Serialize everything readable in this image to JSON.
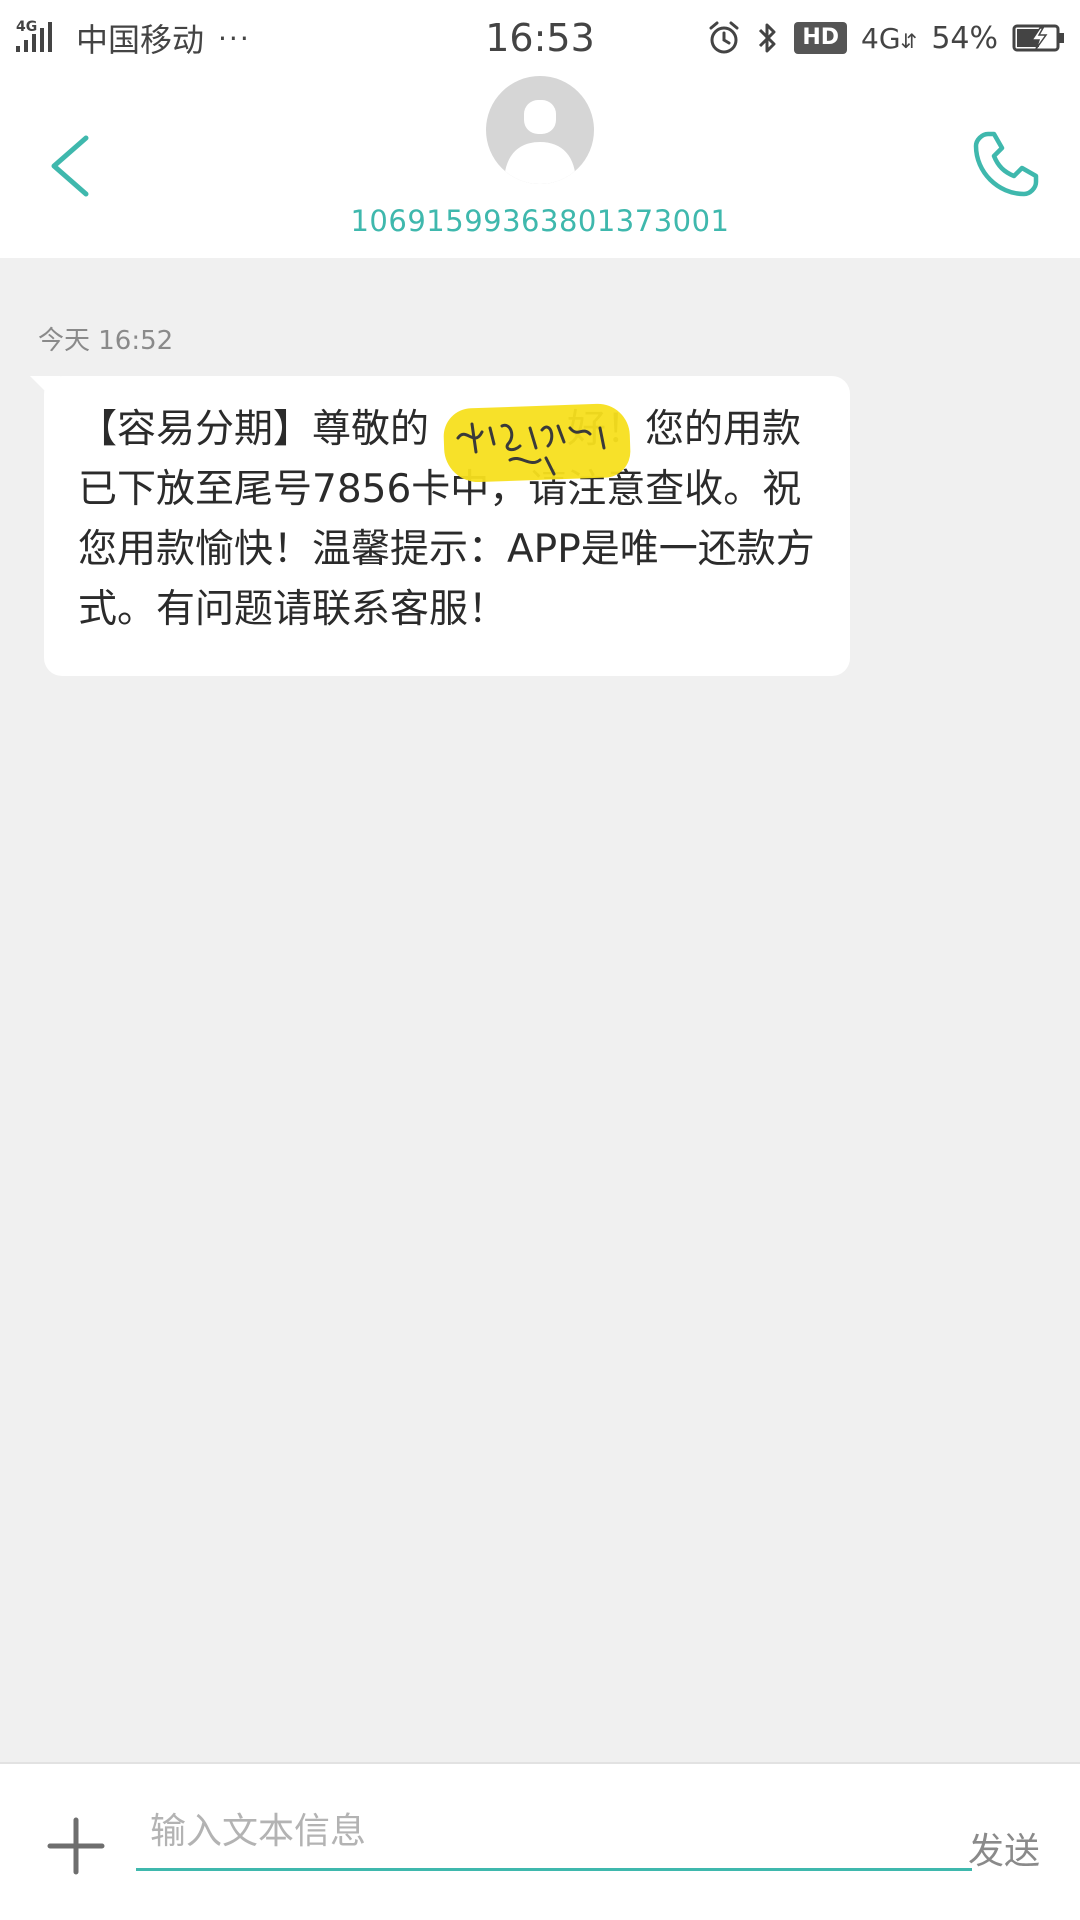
{
  "status_bar": {
    "network_type": "4G",
    "carrier": "中国移动",
    "more": "···",
    "time": "16:53",
    "hd": "HD",
    "net": "4G",
    "battery": "54%"
  },
  "header": {
    "contact_number": "1069159936380137300 1",
    "back_icon": "chevron-left-icon",
    "call_icon": "phone-icon",
    "accent_color": "#3fb8ad"
  },
  "conversation": {
    "timestamp": "今天  16:52",
    "message_before": "【容易分期】尊敬的",
    "message_after": "好！您的用款已下放至尾号7856卡中，请注意查收。祝您用款愉快！温馨提示：APP是唯一还款方式。有问题请联系客服！"
  },
  "composer": {
    "placeholder": "输入文本信息",
    "send_label": "发送",
    "add_icon": "plus-icon"
  }
}
